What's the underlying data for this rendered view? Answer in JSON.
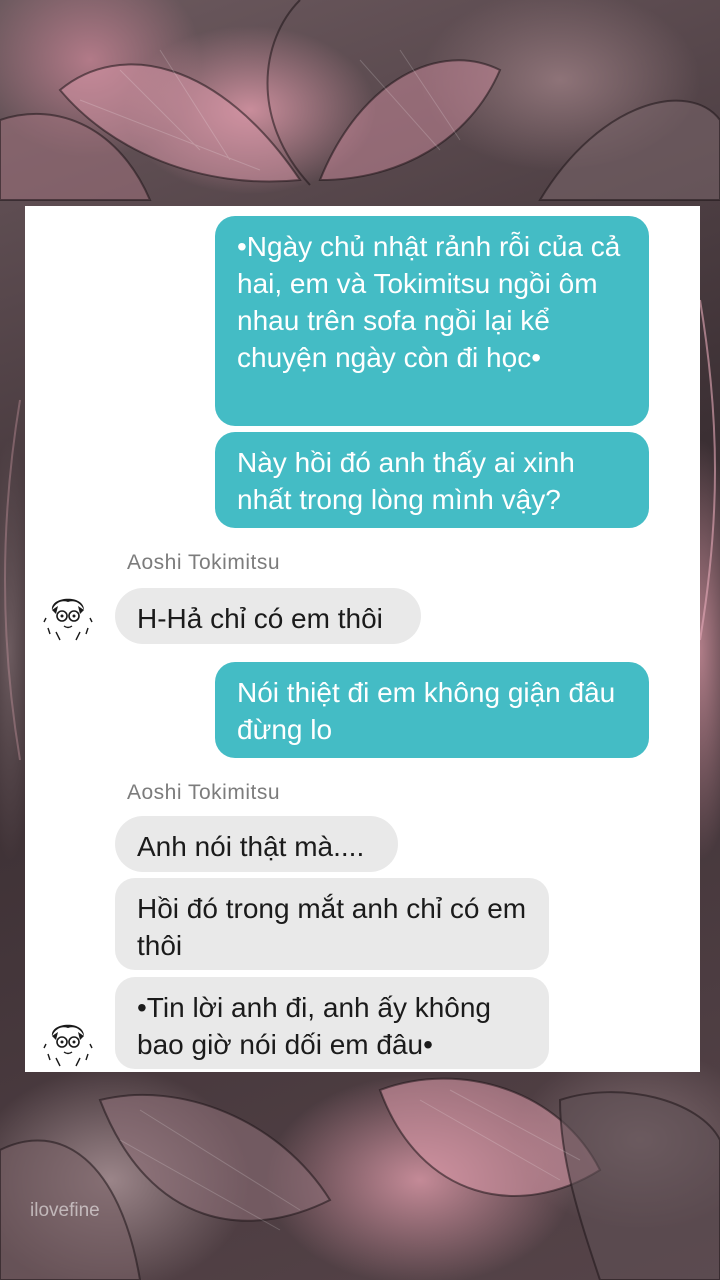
{
  "messages": [
    {
      "side": "me",
      "text": "•Ngày chủ nhật rảnh rỗi của cả hai, em và Tokimitsu ngồi ôm nhau trên sofa ngồi lại kể chuyện ngày còn đi học•"
    },
    {
      "side": "me",
      "text": "Này hồi đó anh thấy ai xinh nhất trong lòng mình vậy?"
    },
    {
      "side": "them",
      "sender": "Aoshi Tokimitsu",
      "text": "H-Hả chỉ có em thôi"
    },
    {
      "side": "me",
      "text": "Nói thiệt đi em không giận đâu đừng lo"
    },
    {
      "side": "them",
      "sender": "Aoshi Tokimitsu",
      "text": "Anh nói thật mà...."
    },
    {
      "side": "them",
      "text": "Hồi đó trong mắt anh chỉ có em thôi"
    },
    {
      "side": "them",
      "text": "•Tin lời anh đi, anh ấy không bao giờ nói dối em đâu•"
    }
  ],
  "watermark": "ilovefine",
  "colors": {
    "outgoing_bubble": "#44bcc5",
    "incoming_bubble": "#e9e9e9",
    "sender_name": "#7c7c7c"
  },
  "icons": {
    "avatar": "chibi-character-avatar-icon"
  }
}
